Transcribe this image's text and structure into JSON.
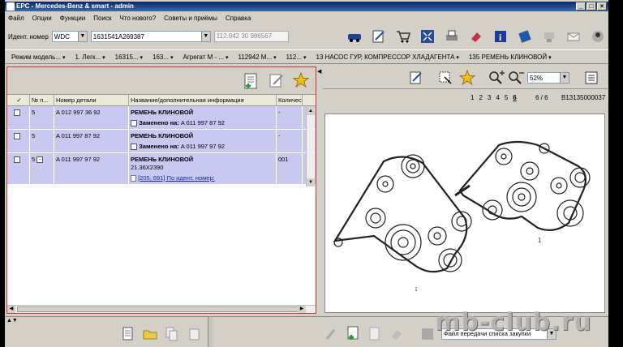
{
  "window": {
    "title": "EPC - Mercedes-Benz & smart - admin"
  },
  "menu": [
    "Файл",
    "Опции",
    "Функции",
    "Поиск",
    "Что нового?",
    "Советы и приёмы",
    "Справка"
  ],
  "ident": {
    "label": "Идент. номер",
    "type_value": "WDC",
    "vin_value": "1631541A269387",
    "engine_value": "112.942 30 986567"
  },
  "breadcrumbs": [
    "Режим модель...",
    "1. Легк...",
    "16315...",
    "163...",
    "Агрегат М - ...",
    "112942 М...",
    "112...",
    "13 НАСОС ГУР, КОМПРЕССОР ХЛАДАГЕНТА",
    "135 РЕМЕНЬ КЛИНОВОЙ"
  ],
  "table": {
    "headers": [
      "✓",
      "№ п...",
      "Номер детали",
      "Название/дополнительная информация",
      "Количес"
    ],
    "rows": [
      {
        "pos": "5",
        "part": "A 012 997 36 92",
        "name": "РЕМЕНЬ КЛИНОВОЙ",
        "replaced_label": "Заменено на:",
        "replaced_value": "A 011 997 87 92",
        "qty": "-"
      },
      {
        "pos": "5",
        "part": "A 011 997 87 92",
        "name": "РЕМЕНЬ КЛИНОВОЙ",
        "replaced_label": "Заменено на:",
        "replaced_value": "A 011 997 97 92",
        "qty": "-"
      },
      {
        "pos": "5",
        "part": "A 011 997 97 92",
        "name": "РЕМЕНЬ КЛИНОВОЙ",
        "size": "21.36X2390",
        "link": "[205, 691] По идент. номер:",
        "qty": "001"
      }
    ]
  },
  "image_panel": {
    "zoom": "52%",
    "pages": [
      "1",
      "2",
      "3",
      "4",
      "5",
      "6"
    ],
    "current_page": "6",
    "page_total": "6 / 6",
    "image_id": "B13135000037",
    "callout_a": "1",
    "callout_b": "1"
  },
  "bottom": {
    "file_label": "Файл передачи списка закупки"
  },
  "watermark": "mb-club.ru"
}
